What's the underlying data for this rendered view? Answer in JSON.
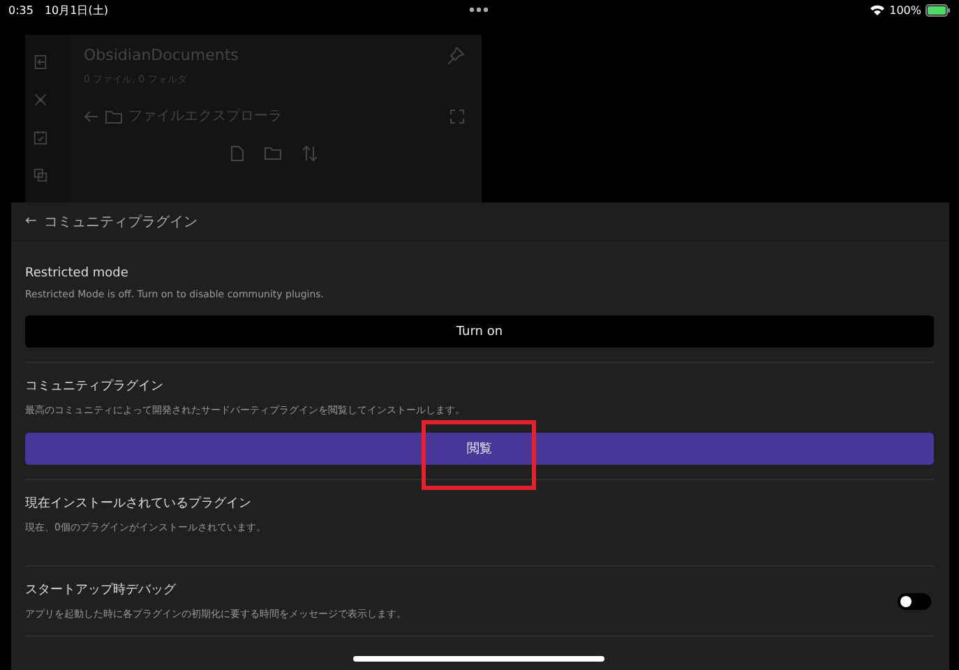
{
  "status_bar": {
    "time": "0:35",
    "date": "10月1日(土)",
    "battery": "100%"
  },
  "background_app": {
    "vault_title": "ObsidianDocuments",
    "vault_counts": "0 ファイル, 0 フォルダ",
    "panel_title": "ファイルエクスプローラ"
  },
  "modal": {
    "back": "←",
    "title": "コミュニティプラグイン",
    "sections": [
      {
        "kind": "button",
        "title": "Restricted mode",
        "description": "Restricted Mode is off. Turn on to disable community plugins.",
        "button": {
          "label": "Turn on",
          "kind": "dark"
        }
      },
      {
        "kind": "button",
        "title": "コミュニティプラグイン",
        "description": "最高のコミュニティによって開発されたサードパーティプラグインを閲覧してインストールします。",
        "button": {
          "label": "閲覧",
          "kind": "primary"
        },
        "highlighted": true
      },
      {
        "kind": "info",
        "title": "現在インストールされているプラグイン",
        "description": "現在、0個のプラグインがインストールされています。"
      },
      {
        "kind": "toggle",
        "title": "スタートアップ時デバッグ",
        "description": "アプリを起動した時に各プラグインの初期化に要する時間をメッセージで表示します。",
        "on": false
      }
    ]
  }
}
